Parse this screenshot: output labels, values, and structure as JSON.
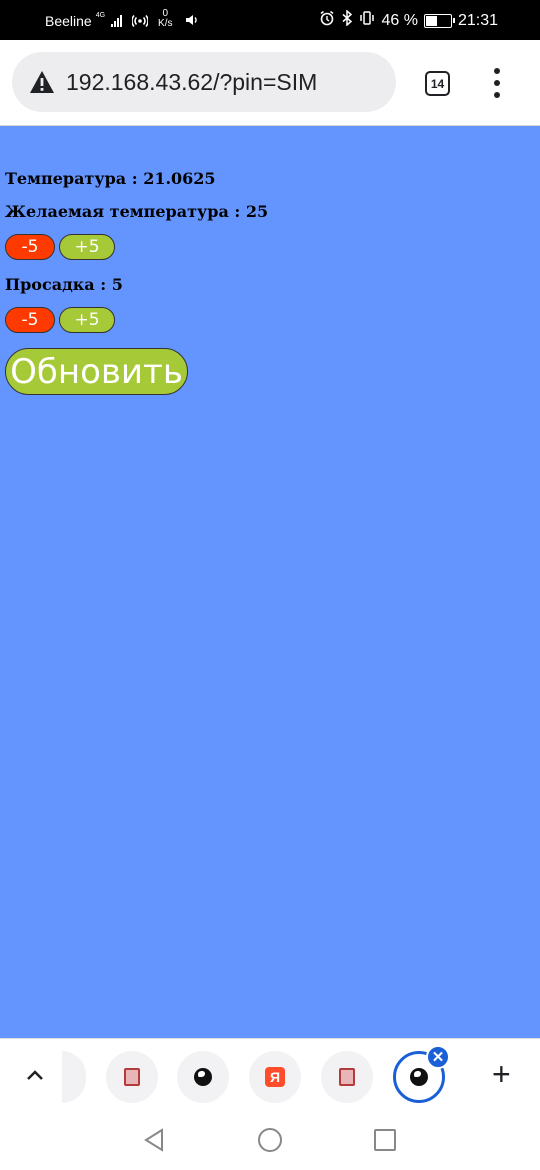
{
  "status_bar": {
    "carrier": "Beeline",
    "network": "4G",
    "speed_value": "0",
    "speed_unit": "K/s",
    "battery_percent": "46 %",
    "battery_level": 0.46,
    "time": "21:31",
    "icons": [
      "hotspot-icon",
      "volume-icon",
      "alarm-icon",
      "bluetooth-icon",
      "vibrate-icon",
      "battery-icon"
    ]
  },
  "browser": {
    "url": "192.168.43.62/?pin=SIM",
    "security_icon": "warning-triangle-icon",
    "tab_count": "14",
    "menu_icon": "more-vert-icon"
  },
  "page": {
    "temperature_text": "Температура : 21.0625",
    "target_temperature_text": "Желаемая температура : 25",
    "sag_text": "Просадка : 5",
    "minus_label": "-5",
    "plus_label": "+5",
    "refresh_label": "Обновить",
    "background_color": "#6495ff",
    "minus_color": "#ff3a00",
    "plus_color": "#a6c937"
  },
  "tab_bar": {
    "tabs": [
      "book-icon",
      "globe-icon",
      "yandex-icon",
      "book-icon",
      "globe-icon"
    ],
    "yandex_letter": "Я",
    "close_symbol": "✕",
    "add_symbol": "+",
    "active_color": "#1a5fd6"
  }
}
